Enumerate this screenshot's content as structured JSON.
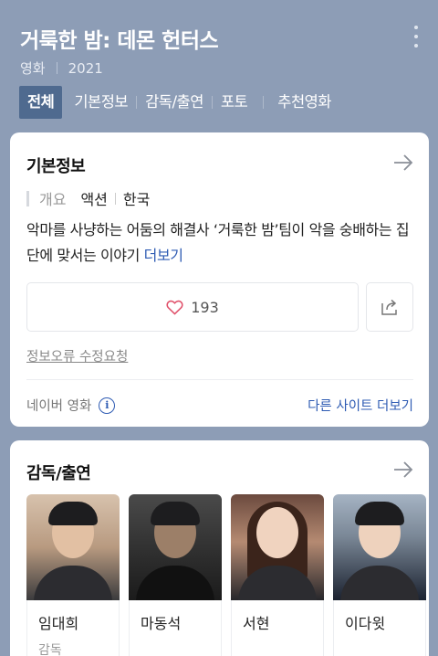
{
  "header": {
    "title": "거룩한 밤: 데몬 헌터스",
    "category": "영화",
    "year": "2021",
    "tabs": [
      {
        "label": "전체",
        "active": true
      },
      {
        "label": "기본정보",
        "active": false
      },
      {
        "label": "감독/출연",
        "active": false
      },
      {
        "label": "포토",
        "active": false
      },
      {
        "label": "추천영화",
        "active": false
      }
    ]
  },
  "basic_info": {
    "title": "기본정보",
    "overview_label": "개요",
    "genre": "액션",
    "country": "한국",
    "summary": "악마를 사냥하는 어둠의 해결사 ‘거룩한 밤’팀이 악을 숭배하는 집단에 맞서는 이야기",
    "more_label": "더보기",
    "like_count": "193",
    "report_label": "정보오류 수정요청",
    "source_label": "네이버 영화",
    "other_sites_label": "다른 사이트 더보기"
  },
  "cast": {
    "title": "감독/출연",
    "people": [
      {
        "name": "임대희",
        "role": "감독"
      },
      {
        "name": "마동석",
        "role": ""
      },
      {
        "name": "서현",
        "role": ""
      },
      {
        "name": "이다윗",
        "role": ""
      }
    ]
  },
  "colors": {
    "header_bg": "#8d9db6",
    "active_tab": "#4f6a8f",
    "link": "#2e5bb3"
  }
}
